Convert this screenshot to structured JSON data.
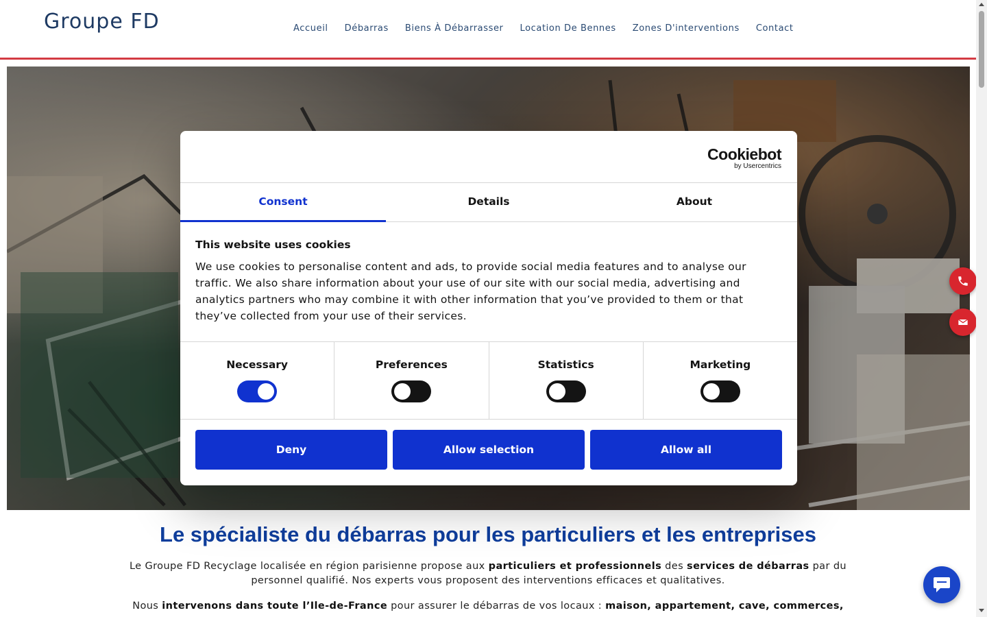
{
  "header": {
    "logo": "Groupe FD",
    "nav": [
      "Accueil",
      "Débarras",
      "Biens À Débarrasser",
      "Location De Bennes",
      "Zones D'interventions",
      "Contact"
    ]
  },
  "floating": {
    "phone_icon": "phone-icon",
    "mail_icon": "mail-icon",
    "chat_icon": "chat-bubble-icon"
  },
  "content": {
    "headline": "Le spécialiste du débarras pour les particuliers et les entreprises",
    "para1": {
      "t1": "Le Groupe FD Recyclage localisée en région parisienne propose aux ",
      "b1": "particuliers et professionnels",
      "t2": " des ",
      "b2": "services de débarras",
      "t3": " par du personnel qualifié. Nos experts vous proposent des interventions efficaces et qualitatives."
    },
    "para2": {
      "t1": "Nous ",
      "b1": "intervenons dans toute l’Ile-de-France",
      "t2": " pour assurer le débarras de vos locaux : ",
      "b2": "maison, appartement, cave, commerces,"
    }
  },
  "cookie": {
    "brand": "Cookiebot",
    "brand_sub": "by Usercentrics",
    "tabs": [
      "Consent",
      "Details",
      "About"
    ],
    "title": "This website uses cookies",
    "text": "We use cookies to personalise content and ads, to provide social media features and to analyse our traffic. We also share information about your use of our site with our social media, advertising and analytics partners who may combine it with other information that you’ve provided to them or that they’ve collected from your use of their services.",
    "toggles": [
      {
        "label": "Necessary",
        "on": true
      },
      {
        "label": "Preferences",
        "on": false
      },
      {
        "label": "Statistics",
        "on": false
      },
      {
        "label": "Marketing",
        "on": false
      }
    ],
    "buttons": {
      "deny": "Deny",
      "selection": "Allow selection",
      "all": "Allow all"
    },
    "accent": "#1032cf"
  },
  "colors": {
    "header_rule": "#d33a43",
    "headline": "#0f3e9d",
    "float_red": "#d8262e",
    "chat_blue": "#1a45c8"
  }
}
